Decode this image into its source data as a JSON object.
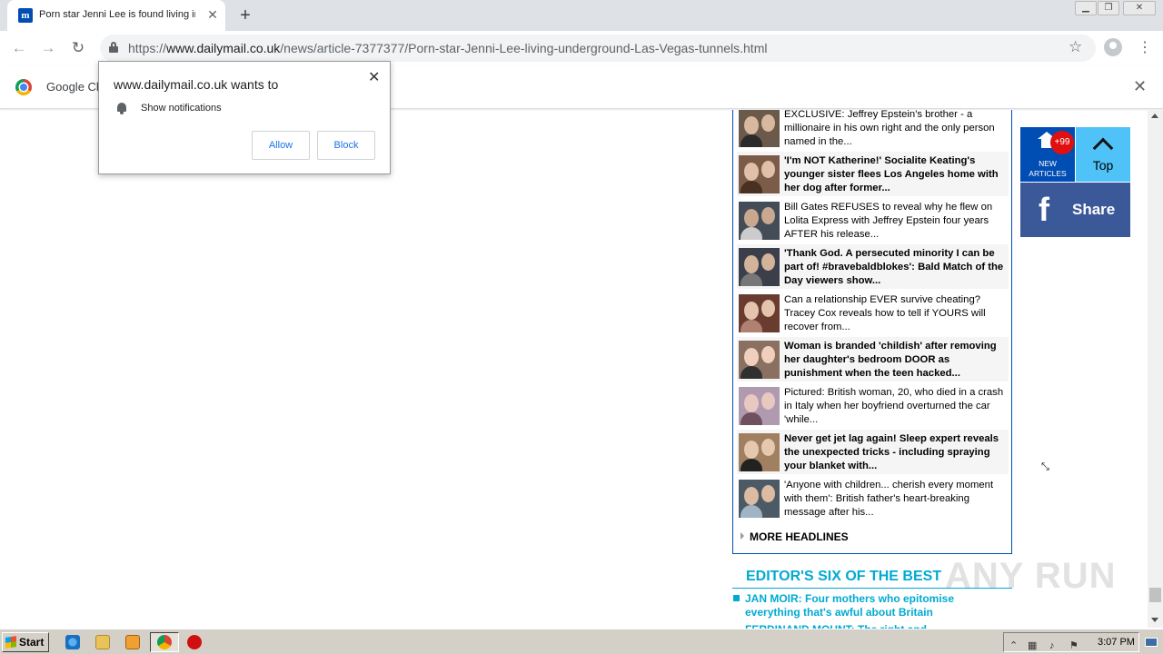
{
  "browser": {
    "tab_title": "Porn star Jenni Lee is found living in",
    "tab_favicon_letter": "m",
    "url_scheme": "https://",
    "url_host": "www.dailymail.co.uk",
    "url_path": "/news/article-7377377/Porn-star-Jenni-Lee-living-underground-Las-Vegas-tunnels.html",
    "infobar_text": "Google Ch"
  },
  "popup": {
    "title": "www.dailymail.co.uk wants to",
    "permission": "Show notifications",
    "allow_label": "Allow",
    "block_label": "Block"
  },
  "headlines": {
    "items": [
      {
        "text": "EXCLUSIVE: Jeffrey Epstein's brother - a millionaire in his own right and the only person named in the...",
        "bold": false
      },
      {
        "text": "'I'm NOT Katherine!' Socialite Keating's younger sister flees Los Angeles home with her dog after former...",
        "bold": true
      },
      {
        "text": "Bill Gates REFUSES to reveal why he flew on Lolita Express with Jeffrey Epstein four years AFTER his release...",
        "bold": false
      },
      {
        "text": "'Thank God. A persecuted minority I can be part of! #bravebaldblokes': Bald Match of the Day viewers show...",
        "bold": true
      },
      {
        "text": "Can a relationship EVER survive cheating? Tracey Cox reveals how to tell if YOURS will recover from...",
        "bold": false
      },
      {
        "text": "Woman is branded 'childish' after removing her daughter's bedroom DOOR as punishment when the teen hacked...",
        "bold": true
      },
      {
        "text": "Pictured: British woman, 20, who died in a crash in Italy when her boyfriend overturned the car 'while...",
        "bold": false
      },
      {
        "text": "Never get jet lag again! Sleep expert reveals the unexpected tricks - including spraying your blanket with...",
        "bold": true
      },
      {
        "text": "'Anyone with children... cherish every moment with them': British father's heart-breaking message after his...",
        "bold": false
      }
    ],
    "more_label": "MORE HEADLINES"
  },
  "editors_six": {
    "title": "EDITOR'S SIX OF THE BEST",
    "item1": "JAN MOIR: Four mothers who epitomise everything that's awful about Britain",
    "item2": "FERDINAND MOUNT: The right and..."
  },
  "widgets": {
    "badge": "+99",
    "new_articles_line1": "NEW",
    "new_articles_line2": "ARTICLES",
    "top_label": "Top",
    "share_label": "Share"
  },
  "watermark": "ANY RUN",
  "taskbar": {
    "start_label": "Start",
    "clock": "3:07 PM"
  },
  "colors": {
    "dailymail_blue": "#004db3",
    "editors_cyan": "#00aad2",
    "facebook_blue": "#3b5998",
    "top_cyan": "#4fc3f7",
    "badge_red": "#e01010"
  }
}
